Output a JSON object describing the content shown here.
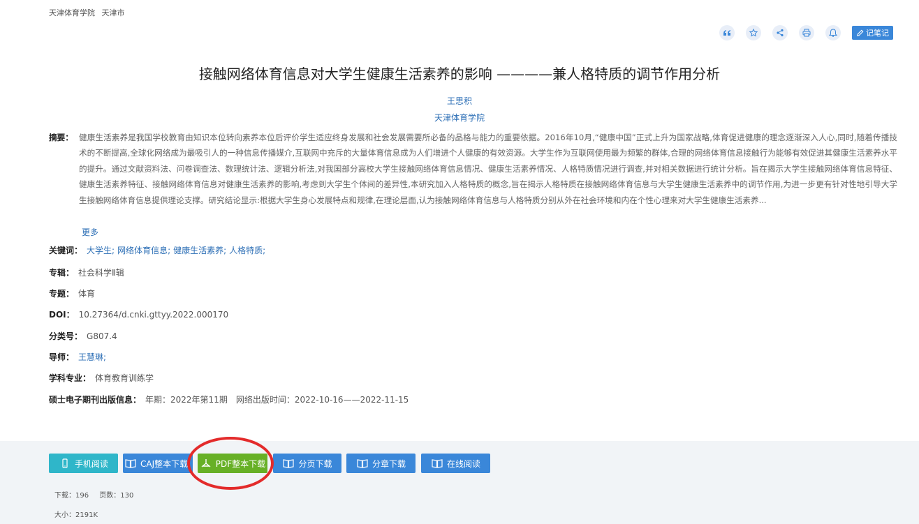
{
  "breadcrumb": {
    "org": "天津体育学院",
    "city": "天津市"
  },
  "toolbar": {
    "note_label": "记笔记",
    "icons": [
      "quote-icon",
      "star-icon",
      "share-icon",
      "print-icon",
      "bell-icon",
      "edit-icon"
    ]
  },
  "paper": {
    "title": "接触网络体育信息对大学生健康生活素养的影响 ————兼人格特质的调节作用分析",
    "author": "王思积",
    "organization": "天津体育学院"
  },
  "abstract": {
    "label": "摘要：",
    "text": "健康生活素养是我国学校教育由知识本位转向素养本位后评价学生适应终身发展和社会发展需要所必备的品格与能力的重要依据。2016年10月,“健康中国”正式上升为国家战略,体育促进健康的理念逐渐深入人心,同时,随着传播技术的不断提高,全球化网络成为最吸引人的一种信息传播媒介,互联网中充斥的大量体育信息成为人们增进个人健康的有效资源。大学生作为互联网使用最为频繁的群体,合理的网络体育信息接触行为能够有效促进其健康生活素养水平的提升。通过文献资料法、问卷调查法、数理统计法、逻辑分析法,对我国部分高校大学生接触网络体育信息情况、健康生活素养情况、人格特质情况进行调查,并对相关数据进行统计分析。旨在揭示大学生接触网络体育信息特征、健康生活素养特征、接触网络体育信息对健康生活素养的影响,考虑到大学生个体间的差异性,本研究加入人格特质的概念,旨在揭示人格特质在接触网络体育信息与大学生健康生活素养中的调节作用,为进一步更有针对性地引导大学生接触网络体育信息提供理论支撑。研究结论显示:根据大学生身心发展特点和规律,在理论层面,认为接触网络体育信息与人格特质分别从外在社会环境和内在个性心理来对大学生健康生活素养...",
    "more": "更多"
  },
  "meta": {
    "keywords_label": "关键词：",
    "keywords": [
      "大学生;",
      "网络体育信息;",
      "健康生活素养;",
      "人格特质;"
    ],
    "series_label": "专辑：",
    "series": "社会科学Ⅱ辑",
    "topic_label": "专题：",
    "topic": "体育",
    "doi_label": "DOI：",
    "doi": "10.27364/d.cnki.gttyy.2022.000170",
    "class_label": "分类号：",
    "class": "G807.4",
    "advisor_label": "导师：",
    "advisor": "王慧琳;",
    "major_label": "学科专业：",
    "major": "体育教育训练学",
    "pub_label": "硕士电子期刊出版信息：",
    "pub_issue": "年期：2022年第11期",
    "pub_online": "网络出版时间：2022-10-16——2022-11-15"
  },
  "actions": {
    "mobile": "手机阅读",
    "caj": "CAJ整本下载",
    "pdf": "PDF整本下载",
    "page": "分页下载",
    "chapter": "分章下载",
    "online": "在线阅读"
  },
  "stats": {
    "downloads": "下载：196",
    "pages": "页数：130",
    "size": "大小：2191K"
  },
  "colors": {
    "accent": "#3a87d9",
    "pdf": "#67b026",
    "mobile": "#2fb6c9",
    "highlight": "#e32b2b"
  }
}
